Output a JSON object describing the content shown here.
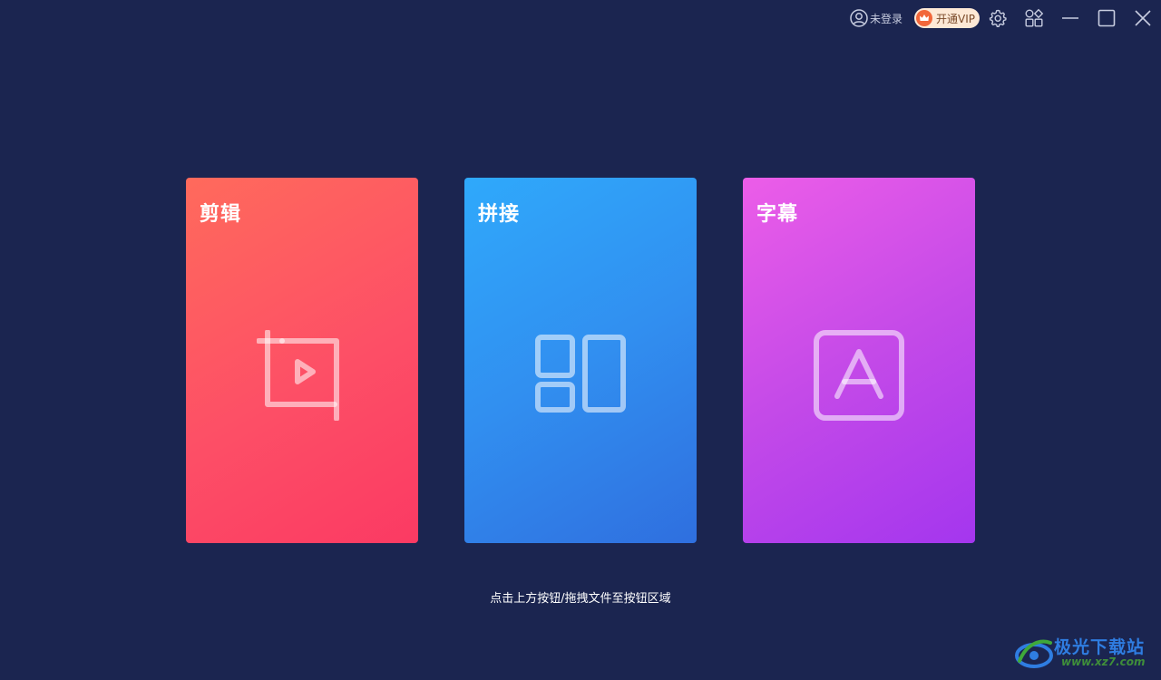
{
  "titlebar": {
    "login_label": "未登录",
    "vip_label": "开通VIP",
    "icons": {
      "user": "user-circle-icon",
      "crown": "crown-icon",
      "settings": "gear-icon",
      "apps": "apps-grid-icon",
      "minimize": "minimize-icon",
      "maximize": "maximize-icon",
      "close": "close-icon"
    }
  },
  "cards": [
    {
      "title": "剪辑",
      "icon": "crop-play-icon",
      "color": "#fd4f66"
    },
    {
      "title": "拼接",
      "icon": "layout-panels-icon",
      "color": "#318ff0"
    },
    {
      "title": "字幕",
      "icon": "letter-a-box-icon",
      "color": "#c44ae8"
    }
  ],
  "hint": "点击上方按钮/拖拽文件至按钮区域",
  "watermark": {
    "name": "极光下载站",
    "url": "www.xz7.com"
  },
  "colors": {
    "background": "#1b2550",
    "vip_bg": "#fde9d6",
    "vip_crown": "#f2673a"
  }
}
